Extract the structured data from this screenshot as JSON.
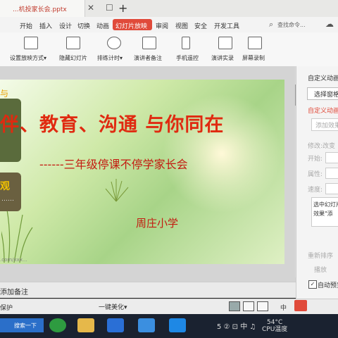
{
  "window": {
    "doc_tab": "...机投家长会.pptx",
    "close_glyph": "✕",
    "sep_glyph": "☐",
    "new_tab": "+"
  },
  "menu": {
    "items": [
      "开始",
      "插入",
      "设计",
      "切换",
      "动画",
      "幻灯片放映",
      "审阅",
      "视图",
      "安全",
      "开发工具"
    ],
    "search_placeholder": "查找命令...",
    "accent": "#e04a3a"
  },
  "toolbar": {
    "tools": [
      {
        "label": "设置放映方式▾",
        "icon": "slideshow-settings-icon"
      },
      {
        "label": "隐藏幻灯片",
        "icon": "hide-slide-icon"
      },
      {
        "label": "排练计时▾",
        "icon": "timer-icon"
      },
      {
        "label": "演讲者备注",
        "icon": "notes-icon"
      },
      {
        "label": "手机遥控",
        "icon": "phone-icon"
      },
      {
        "label": "演讲实录",
        "icon": "record-icon"
      },
      {
        "label": "屏幕录制",
        "icon": "screen-record-icon"
      }
    ]
  },
  "slide": {
    "title": "伴、教育、沟通 与你同在",
    "subtitle": "------三年级停课不停学家长会",
    "school": "周庄小学",
    "left_panel_1": "与",
    "left_panel_2": "观",
    "left_panel_2_dots": "……",
    "watermark": ".com/xxx..."
  },
  "notes": {
    "label": "添加备注"
  },
  "right_panel": {
    "title": "自定义动画",
    "select_pane": "选择窗格",
    "custom_anim": "自定义动画",
    "add_effect": "添加效果",
    "modify": "修改:改变",
    "start": "开始:",
    "property": "属性:",
    "speed": "速度:",
    "list_line1": "选中幻灯片",
    "list_line2": "效果\"添",
    "reorder": "重新排序",
    "play": "播放",
    "auto_preview": "自动预览",
    "auto_checked": "✓"
  },
  "status": {
    "protect": "保护",
    "beautify": "一键美化▾",
    "tray_text": "中"
  },
  "taskbar": {
    "search": "搜索一下",
    "cpu_temp_value": "54°C",
    "cpu_temp_label": "CPU温度",
    "tray": "5 ② ⊡ 中 ♫"
  }
}
